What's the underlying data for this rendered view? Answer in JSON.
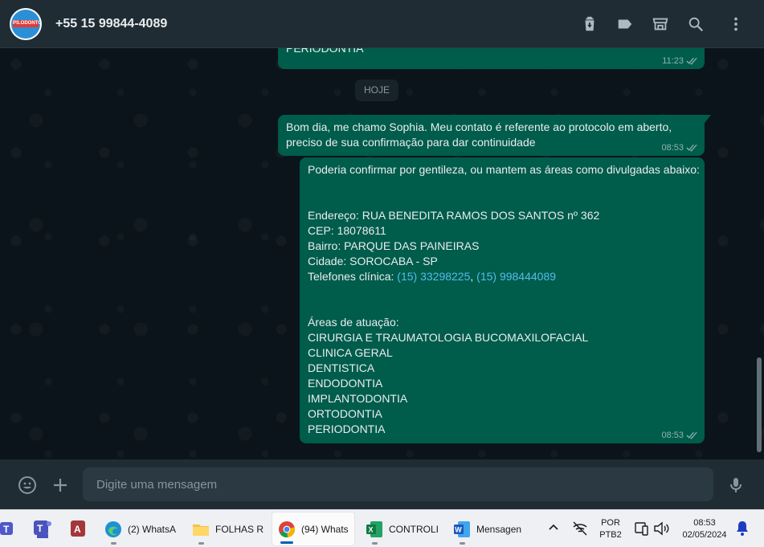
{
  "header": {
    "contact_name": "+55 15 99844-4089",
    "avatar_text": "PS.ODONTO",
    "icons": [
      "delete-icon",
      "label-icon",
      "store-icon",
      "search-icon",
      "menu-icon"
    ]
  },
  "messages": [
    {
      "lines": [
        "PERIODONTIA"
      ],
      "time": "11:23"
    },
    {
      "lines": [
        "Bom dia, me chamo Sophia. Meu contato é referente ao protocolo em aberto, preciso de sua confirmação para dar continuidade"
      ],
      "time": "08:53"
    },
    {
      "intro": "Poderia confirmar por gentileza, ou mantem as áreas como divulgadas abaixo:",
      "address": "Endereço: RUA BENEDITA RAMOS DOS SANTOS nº 362",
      "cep": "CEP: 18078611",
      "bairro": "Bairro: PARQUE DAS PAINEIRAS",
      "cidade": "Cidade: SOROCABA - SP",
      "phones_label": "Telefones clínica: ",
      "phone_1": "(15) 33298225",
      "phone_sep": ", ",
      "phone_2": "(15) 998444089",
      "areas_label": "Áreas de atuação:",
      "areas": [
        "CIRURGIA E TRAUMATOLOGIA BUCOMAXILOFACIAL",
        "CLINICA GERAL",
        "DENTISTICA",
        "ENDODONTIA",
        "IMPLANTODONTIA",
        "ORTODONTIA",
        "PERIODONTIA"
      ],
      "time": "08:53"
    }
  ],
  "date_separator": "HOJE",
  "composer": {
    "placeholder": "Digite uma mensagem"
  },
  "taskbar": {
    "items": [
      {
        "label": "(2) WhatsA"
      },
      {
        "label": "FOLHAS R"
      },
      {
        "label": "(94) Whats"
      },
      {
        "label": "CONTROLI"
      },
      {
        "label": "Mensagen"
      }
    ],
    "lang_1": "POR",
    "lang_2": "PTB2",
    "clock_time": "08:53",
    "clock_date": "02/05/2024"
  },
  "colors": {
    "bubble_out": "#005c4b",
    "header_bg": "#202c33",
    "chat_bg": "#0b141a",
    "link": "#53bdeb"
  }
}
